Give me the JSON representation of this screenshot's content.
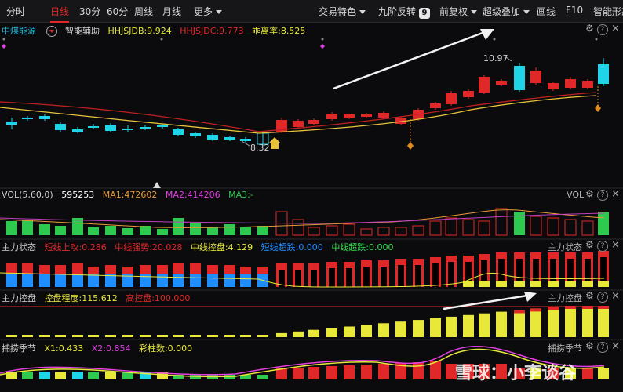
{
  "toolbar": {
    "tabs": [
      "分时",
      "日线",
      "30分",
      "60分",
      "周线",
      "月线",
      "更多"
    ],
    "active_tab": "日线",
    "right_items": [
      "交易特色",
      "九阶反转",
      "前复权",
      "超级叠加",
      "画线",
      "F10",
      "智能形态"
    ],
    "nine_badge": "9"
  },
  "main_panel": {
    "stock_name": "中煤能源",
    "assistant_label": "智能辅助",
    "indicators": [
      {
        "label": "HHJSJDB:9.924",
        "color": "#e8e83a"
      },
      {
        "label": "HHJSJDC:9.773",
        "color": "#e02828"
      },
      {
        "label": "乖离率:8.525",
        "color": "#e8e83a"
      }
    ],
    "high_label": "10.97",
    "low_label": "8.32"
  },
  "vol_panel": {
    "title": "VOL(5,60,0)",
    "value": "595253",
    "ma1": "MA1:472602",
    "ma2": "MA2:414206",
    "ma3": "MA3:-",
    "right_title": "VOL"
  },
  "zhuli_state_panel": {
    "title": "主力状态",
    "items": [
      {
        "label": "短线上攻:0.286",
        "color": "#e02828"
      },
      {
        "label": "中线强势:20.028",
        "color": "#e02828"
      },
      {
        "label": "中线控盘:4.129",
        "color": "#e8e83a"
      },
      {
        "label": "短线超跌:0.000",
        "color": "#1f8fff"
      },
      {
        "label": "中线超跌:0.000",
        "color": "#2ee04a"
      }
    ],
    "right_title": "主力状态"
  },
  "control_panel": {
    "title": "主力控盘",
    "items": [
      {
        "label": "控盘程度:115.612",
        "color": "#e8e83a"
      },
      {
        "label": "高控盘:100.000",
        "color": "#e02828"
      }
    ],
    "right_title": "主力控盘"
  },
  "fishing_panel": {
    "title": "捕捞季节",
    "items": [
      {
        "label": "X1:0.433",
        "color": "#e8e83a"
      },
      {
        "label": "X2:0.854",
        "color": "#e040e0"
      },
      {
        "label": "彩柱数:0.000",
        "color": "#e8e83a"
      }
    ],
    "right_title": "捕捞季节"
  },
  "watermark": "雪球：小李谈谷",
  "colors": {
    "up": "#e02828",
    "down": "#1fd4e6",
    "vol_down": "#2ec94f",
    "yellow": "#e8e83a"
  }
}
